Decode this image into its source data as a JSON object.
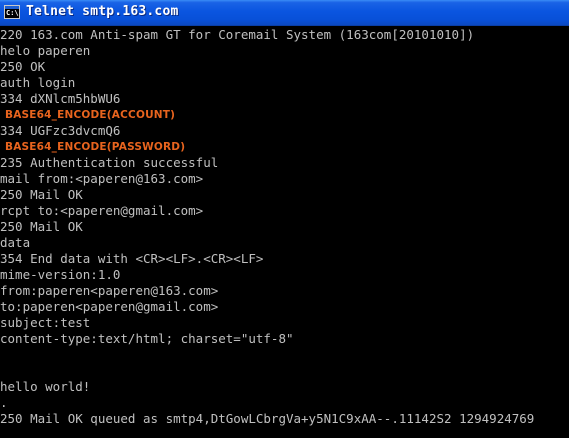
{
  "window": {
    "title": "Telnet smtp.163.com",
    "icon": "console-icon",
    "icon_glyph": "C:\\"
  },
  "console": {
    "lines": [
      {
        "text": "220 163.com Anti-spam GT for Coremail System (163com[20101010])",
        "type": "server"
      },
      {
        "text": "helo paperen",
        "type": "client"
      },
      {
        "text": "250 OK",
        "type": "server"
      },
      {
        "text": "auth login",
        "type": "client"
      },
      {
        "text": "334 dXNlcm5hbWU6",
        "type": "server"
      },
      {
        "text": "BASE64_ENCODE(ACCOUNT)",
        "type": "annotation"
      },
      {
        "text": "334 UGFzc3dvcmQ6",
        "type": "server"
      },
      {
        "text": "BASE64_ENCODE(PASSWORD)",
        "type": "annotation"
      },
      {
        "text": "235 Authentication successful",
        "type": "server"
      },
      {
        "text": "mail from:<paperen@163.com>",
        "type": "client"
      },
      {
        "text": "250 Mail OK",
        "type": "server"
      },
      {
        "text": "rcpt to:<paperen@gmail.com>",
        "type": "client"
      },
      {
        "text": "250 Mail OK",
        "type": "server"
      },
      {
        "text": "data",
        "type": "client"
      },
      {
        "text": "354 End data with <CR><LF>.<CR><LF>",
        "type": "server"
      },
      {
        "text": "mime-version:1.0",
        "type": "client"
      },
      {
        "text": "from:paperen<paperen@163.com>",
        "type": "client"
      },
      {
        "text": "to:paperen<paperen@gmail.com>",
        "type": "client"
      },
      {
        "text": "subject:test",
        "type": "client"
      },
      {
        "text": "content-type:text/html; charset=\"utf-8\"",
        "type": "client"
      },
      {
        "text": "",
        "type": "blank"
      },
      {
        "text": "",
        "type": "blank"
      },
      {
        "text": "hello world!",
        "type": "client"
      },
      {
        "text": ".",
        "type": "client"
      },
      {
        "text": "250 Mail OK queued as smtp4,DtGowLCbrgVa+y5N1C9xAA--.11142S2 1294924769",
        "type": "server"
      }
    ]
  },
  "colors": {
    "console_background": "#000000",
    "console_text": "#c0c0c0",
    "annotation_text": "#e8641e",
    "titlebar_blue": "#0a55e0",
    "title_text": "#ffffff"
  }
}
